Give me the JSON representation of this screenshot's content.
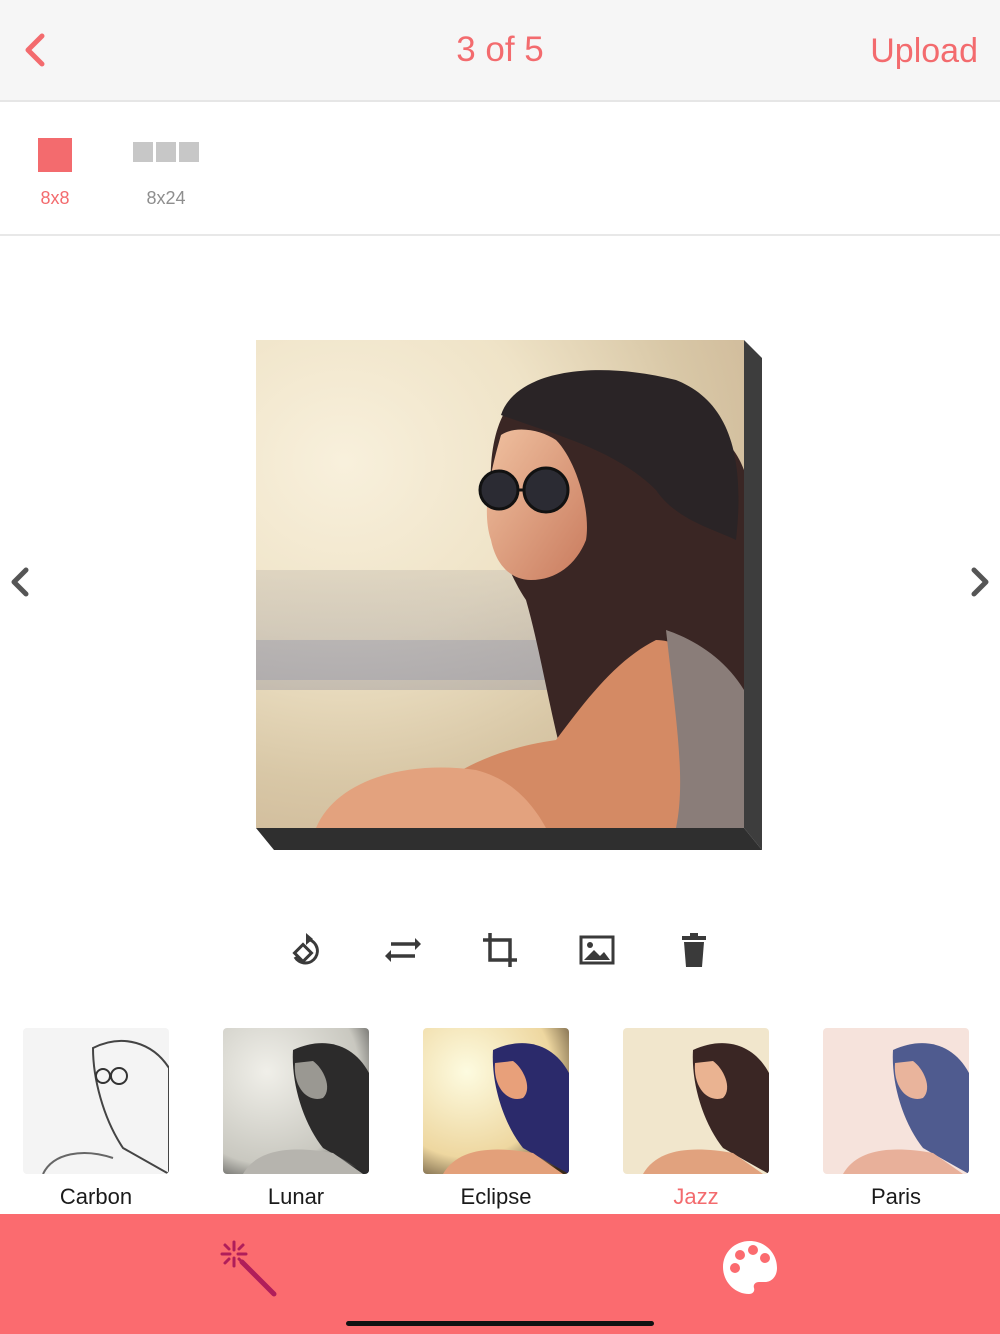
{
  "header": {
    "back_icon": "chevron-left-icon",
    "title": "3 of 5",
    "upload_label": "Upload",
    "accent": "#f36b6e"
  },
  "sizes": {
    "options": [
      {
        "label": "8x8",
        "selected": true
      },
      {
        "label": "8x24",
        "selected": false
      }
    ]
  },
  "preview": {
    "prev_icon": "chevron-left-icon",
    "next_icon": "chevron-right-icon"
  },
  "tools": [
    {
      "icon": "rotate-icon"
    },
    {
      "icon": "flip-icon"
    },
    {
      "icon": "crop-icon"
    },
    {
      "icon": "image-icon"
    },
    {
      "icon": "trash-icon"
    }
  ],
  "filters": [
    {
      "name": "Carbon",
      "selected": false
    },
    {
      "name": "Lunar",
      "selected": false
    },
    {
      "name": "Eclipse",
      "selected": false
    },
    {
      "name": "Jazz",
      "selected": true
    },
    {
      "name": "Paris",
      "selected": false
    }
  ],
  "bottom_bar": {
    "color": "#fb6b6f",
    "items": [
      {
        "icon": "magic-wand-icon",
        "selected": true
      },
      {
        "icon": "palette-icon",
        "selected": false
      }
    ]
  }
}
